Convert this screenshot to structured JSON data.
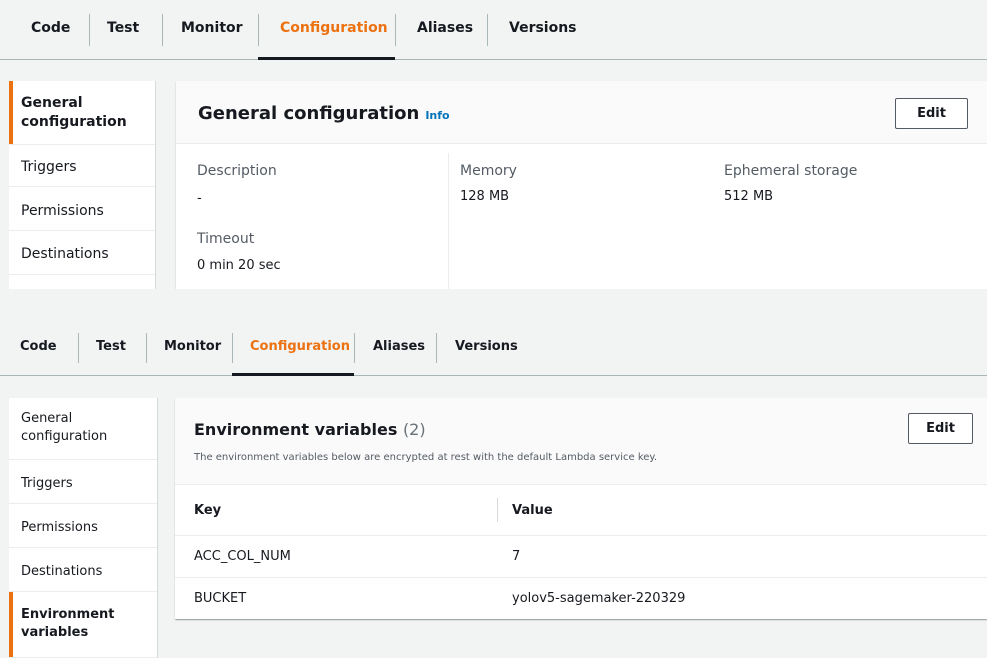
{
  "tabs": [
    "Code",
    "Test",
    "Monitor",
    "Configuration",
    "Aliases",
    "Versions"
  ],
  "active_tab": "Configuration",
  "accent_color": "#ec7211",
  "link_color": "#0073bb",
  "panel1": {
    "nav": [
      "General configuration",
      "Triggers",
      "Permissions",
      "Destinations"
    ],
    "title": "General configuration",
    "info_label": "Info",
    "edit_label": "Edit",
    "description_label": "Description",
    "description_value": "-",
    "timeout_label": "Timeout",
    "timeout_value": "0 min  20 sec",
    "memory_label": "Memory",
    "memory_value": "128 MB",
    "ephemeral_label": "Ephemeral storage",
    "ephemeral_value": "512 MB"
  },
  "panel2": {
    "nav": [
      "General configuration",
      "Triggers",
      "Permissions",
      "Destinations",
      "Environment variables"
    ],
    "title": "Environment variables",
    "count": "(2)",
    "subtitle": "The environment variables below are encrypted at rest with the default Lambda service key.",
    "edit_label": "Edit",
    "columns": [
      "Key",
      "Value"
    ],
    "rows": [
      {
        "key": "ACC_COL_NUM",
        "value": "7"
      },
      {
        "key": "BUCKET",
        "value": "yolov5-sagemaker-220329"
      }
    ]
  }
}
